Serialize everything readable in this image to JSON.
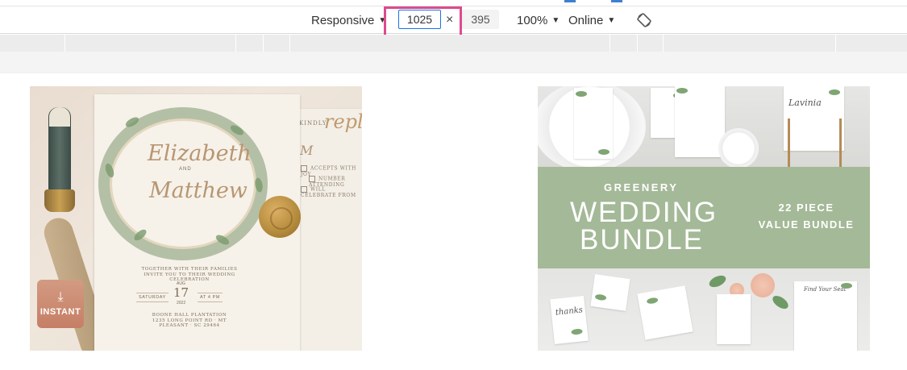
{
  "device_toolbar": {
    "device_mode": "Responsive",
    "width_value": "1025",
    "height_value": "395",
    "dimension_separator": "×",
    "zoom": "100%",
    "throttling": "Online",
    "rotate_icon": "rotate-icon"
  },
  "content": {
    "left_product": {
      "badge_label": "INSTANT",
      "badge_icon": "download-icon",
      "invite_first_name": "Elizabeth",
      "invite_and": "AND",
      "invite_second_name": "Matthew",
      "invite_line1": "TOGETHER WITH THEIR FAMILIES",
      "invite_line2": "INVITE YOU TO THEIR WEDDING CELEBRATION",
      "invite_day": "SATURDAY",
      "invite_month": "AUG",
      "invite_date": "17",
      "invite_year": "2022",
      "invite_time": "AT 4 PM",
      "invite_venue": "BOONE HALL PLANTATION",
      "invite_address": "1235 LONG POINT RD · MT PLEASANT · SC 29464",
      "reply_kindly": "KINDLY",
      "reply_script": "reply",
      "reply_m": "M",
      "reply_accept": "ACCEPTS WITH JOY",
      "reply_number": "NUMBER ATTENDING",
      "reply_regret": "WILL CELEBRATE FROM"
    },
    "right_product": {
      "line_greenery": "GREENERY",
      "line_wedding": "WEDDING",
      "line_bundle": "BUNDLE",
      "line_piece": "22 PIECE",
      "line_value": "VALUE BUNDLE",
      "mini_script_1": "Lavinia",
      "mini_script_2": "thanks",
      "mini_script_3": "Find Your Seat"
    }
  },
  "colors": {
    "highlight_box": "#de4a8e",
    "input_border": "#1a73e8",
    "banner_green": "#a4b997",
    "badge": "#c98a71"
  }
}
